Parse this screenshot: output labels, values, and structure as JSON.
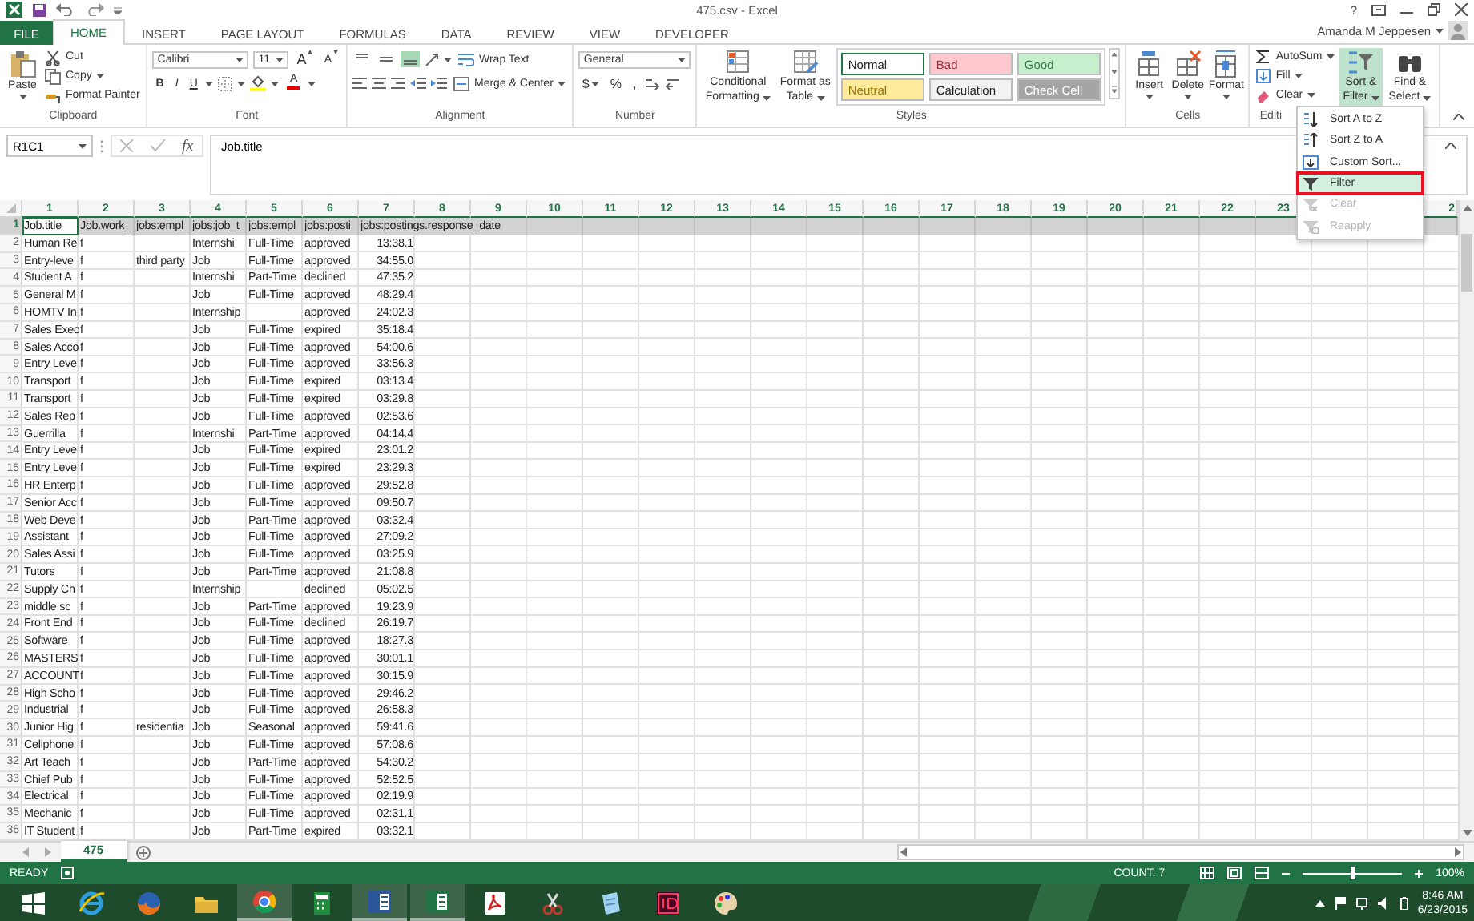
{
  "title_bar": {
    "title": "475.csv - Excel",
    "help": "?"
  },
  "tabs": [
    {
      "label": "FILE",
      "kind": "file",
      "selected": false
    },
    {
      "label": "HOME",
      "kind": "tab",
      "selected": true
    },
    {
      "label": "INSERT",
      "kind": "tab",
      "selected": false
    },
    {
      "label": "PAGE LAYOUT",
      "kind": "tab",
      "selected": false
    },
    {
      "label": "FORMULAS",
      "kind": "tab",
      "selected": false
    },
    {
      "label": "DATA",
      "kind": "tab",
      "selected": false
    },
    {
      "label": "REVIEW",
      "kind": "tab",
      "selected": false
    },
    {
      "label": "VIEW",
      "kind": "tab",
      "selected": false
    },
    {
      "label": "DEVELOPER",
      "kind": "tab",
      "selected": false
    }
  ],
  "account": {
    "name": "Amanda M Jeppesen"
  },
  "ribbon": {
    "groups": [
      {
        "kind": "clipboard",
        "label": "Clipboard",
        "paste": "Paste",
        "commands": [
          "Cut",
          "Copy",
          "Format Painter"
        ]
      },
      {
        "kind": "font",
        "label": "Font",
        "font_name": "Calibri",
        "font_size": "11",
        "grow": "A",
        "shrink": "A",
        "styles": [
          "B",
          "I",
          "U"
        ],
        "color_letter": "A"
      },
      {
        "kind": "alignment",
        "label": "Alignment",
        "vertical_alignment": [
          {
            "selected": false
          },
          {
            "selected": false
          },
          {
            "selected": true
          }
        ],
        "commands": [
          "Wrap Text",
          "Merge & Center"
        ]
      },
      {
        "kind": "number",
        "label": "Number",
        "format": "General",
        "symbols": [
          "$",
          "%",
          ","
        ]
      },
      {
        "kind": "styles",
        "label": "Styles",
        "commands": [
          [
            "Conditional",
            "Formatting"
          ],
          [
            "Format as",
            "Table"
          ]
        ],
        "cell_styles": [
          {
            "label": "Normal",
            "color": "#ffffff",
            "selected": true
          },
          {
            "label": "Bad",
            "color": "#ffc7ce",
            "selected": false
          },
          {
            "label": "Good",
            "color": "#c6efce",
            "selected": false
          },
          {
            "label": "Neutral",
            "color": "#ffeb9c",
            "selected": false
          },
          {
            "label": "Calculation",
            "color": "#f2f2f2",
            "selected": false
          },
          {
            "label": "Check Cell",
            "color": "#a5a5a5",
            "selected": false
          }
        ]
      },
      {
        "kind": "cells",
        "label": "Cells",
        "commands": [
          "Insert",
          "Delete",
          "Format"
        ]
      },
      {
        "kind": "editing",
        "label": "Editi",
        "commands": [
          "AutoSum",
          "Fill",
          "Clear"
        ],
        "sort": {
          "lines": [
            "Sort &",
            "Filter"
          ],
          "active": true
        },
        "find": [
          "Find &",
          "Select"
        ]
      }
    ]
  },
  "formula_bar": {
    "name_box": "R1C1",
    "function_symbol": "fx",
    "content": "Job.title"
  },
  "sheet": {
    "columns": [
      "1",
      "2",
      "3",
      "4",
      "5",
      "6",
      "7",
      "8",
      "9",
      "10",
      "11",
      "12",
      "13",
      "14",
      "15",
      "16",
      "17",
      "18",
      "19",
      "20",
      "21",
      "22",
      "23",
      null,
      null,
      "2"
    ],
    "rows": [
      {
        "header": "1",
        "selected": true,
        "cells": [
          "Job.title",
          "Job.work_",
          "jobs:empl",
          "jobs:job_t",
          "jobs:empl",
          "jobs:posti",
          "jobs:postings.response_date"
        ]
      },
      {
        "header": "2",
        "selected": false,
        "cells": [
          "Human Re",
          "f",
          null,
          "Internshi",
          "Full-Time",
          "approved",
          "13:38.1"
        ]
      },
      {
        "header": "3",
        "selected": false,
        "cells": [
          "Entry-leve",
          "f",
          "third party",
          "Job",
          "Full-Time",
          "approved",
          "34:55.0"
        ]
      },
      {
        "header": "4",
        "selected": false,
        "cells": [
          "Student A",
          "f",
          null,
          "Internshi",
          "Part-Time",
          "declined",
          "47:35.2"
        ]
      },
      {
        "header": "5",
        "selected": false,
        "cells": [
          "General M",
          "f",
          null,
          "Job",
          "Full-Time",
          "approved",
          "48:29.4"
        ]
      },
      {
        "header": "6",
        "selected": false,
        "cells": [
          "HOMTV In",
          "f",
          null,
          "Internship",
          null,
          "approved",
          "24:02.3"
        ]
      },
      {
        "header": "7",
        "selected": false,
        "cells": [
          "Sales Exec",
          "f",
          null,
          "Job",
          "Full-Time",
          "expired",
          "35:18.4"
        ]
      },
      {
        "header": "8",
        "selected": false,
        "cells": [
          "Sales Acco",
          "f",
          null,
          "Job",
          "Full-Time",
          "approved",
          "54:00.6"
        ]
      },
      {
        "header": "9",
        "selected": false,
        "cells": [
          "Entry Leve",
          "f",
          null,
          "Job",
          "Full-Time",
          "approved",
          "33:56.3"
        ]
      },
      {
        "header": "10",
        "selected": false,
        "cells": [
          "Transport",
          "f",
          null,
          "Job",
          "Full-Time",
          "expired",
          "03:13.4"
        ]
      },
      {
        "header": "11",
        "selected": false,
        "cells": [
          "Transport",
          "f",
          null,
          "Job",
          "Full-Time",
          "expired",
          "03:29.8"
        ]
      },
      {
        "header": "12",
        "selected": false,
        "cells": [
          "Sales Rep",
          "f",
          null,
          "Job",
          "Full-Time",
          "approved",
          "02:53.6"
        ]
      },
      {
        "header": "13",
        "selected": false,
        "cells": [
          "Guerrilla",
          "f",
          null,
          "Internshi",
          "Part-Time",
          "approved",
          "04:14.4"
        ]
      },
      {
        "header": "14",
        "selected": false,
        "cells": [
          "Entry Leve",
          "f",
          null,
          "Job",
          "Full-Time",
          "expired",
          "23:01.2"
        ]
      },
      {
        "header": "15",
        "selected": false,
        "cells": [
          "Entry Leve",
          "f",
          null,
          "Job",
          "Full-Time",
          "expired",
          "23:29.3"
        ]
      },
      {
        "header": "16",
        "selected": false,
        "cells": [
          "HR Enterp",
          "f",
          null,
          "Job",
          "Full-Time",
          "approved",
          "29:52.8"
        ]
      },
      {
        "header": "17",
        "selected": false,
        "cells": [
          "Senior Acc",
          "f",
          null,
          "Job",
          "Full-Time",
          "approved",
          "09:50.7"
        ]
      },
      {
        "header": "18",
        "selected": false,
        "cells": [
          "Web Deve",
          "f",
          null,
          "Job",
          "Part-Time",
          "approved",
          "03:32.4"
        ]
      },
      {
        "header": "19",
        "selected": false,
        "cells": [
          "Assistant",
          "f",
          null,
          "Job",
          "Full-Time",
          "approved",
          "27:09.2"
        ]
      },
      {
        "header": "20",
        "selected": false,
        "cells": [
          "Sales Assi",
          "f",
          null,
          "Job",
          "Full-Time",
          "approved",
          "03:25.9"
        ]
      },
      {
        "header": "21",
        "selected": false,
        "cells": [
          "Tutors",
          "f",
          null,
          "Job",
          "Part-Time",
          "approved",
          "21:08.8"
        ]
      },
      {
        "header": "22",
        "selected": false,
        "cells": [
          "Supply Ch",
          "f",
          null,
          "Internship",
          null,
          "declined",
          "05:02.5"
        ]
      },
      {
        "header": "23",
        "selected": false,
        "cells": [
          "middle sc",
          "f",
          null,
          "Job",
          "Part-Time",
          "approved",
          "19:23.9"
        ]
      },
      {
        "header": "24",
        "selected": false,
        "cells": [
          "Front End",
          "f",
          null,
          "Job",
          "Full-Time",
          "declined",
          "26:19.7"
        ]
      },
      {
        "header": "25",
        "selected": false,
        "cells": [
          "Software",
          "f",
          null,
          "Job",
          "Full-Time",
          "approved",
          "18:27.3"
        ]
      },
      {
        "header": "26",
        "selected": false,
        "cells": [
          "MASTERS",
          "f",
          null,
          "Job",
          "Full-Time",
          "approved",
          "30:01.1"
        ]
      },
      {
        "header": "27",
        "selected": false,
        "cells": [
          "ACCOUNT",
          "f",
          null,
          "Job",
          "Full-Time",
          "approved",
          "30:15.9"
        ]
      },
      {
        "header": "28",
        "selected": false,
        "cells": [
          "High Scho",
          "f",
          null,
          "Job",
          "Full-Time",
          "approved",
          "29:46.2"
        ]
      },
      {
        "header": "29",
        "selected": false,
        "cells": [
          "Industrial",
          "f",
          null,
          "Job",
          "Full-Time",
          "approved",
          "26:58.3"
        ]
      },
      {
        "header": "30",
        "selected": false,
        "cells": [
          "Junior Hig",
          "f",
          "residentia",
          "Job",
          "Seasonal",
          "approved",
          "59:41.6"
        ]
      },
      {
        "header": "31",
        "selected": false,
        "cells": [
          "Cellphone",
          "f",
          null,
          "Job",
          "Full-Time",
          "approved",
          "57:08.6"
        ]
      },
      {
        "header": "32",
        "selected": false,
        "cells": [
          "Art Teach",
          "f",
          null,
          "Job",
          "Part-Time",
          "approved",
          "54:30.2"
        ]
      },
      {
        "header": "33",
        "selected": false,
        "cells": [
          "Chief Pub",
          "f",
          null,
          "Job",
          "Full-Time",
          "approved",
          "52:52.5"
        ]
      },
      {
        "header": "34",
        "selected": false,
        "cells": [
          "Electrical",
          "f",
          null,
          "Job",
          "Full-Time",
          "approved",
          "02:19.9"
        ]
      },
      {
        "header": "35",
        "selected": false,
        "cells": [
          "Mechanic",
          "f",
          null,
          "Job",
          "Full-Time",
          "approved",
          "02:31.1"
        ]
      },
      {
        "header": "36",
        "selected": false,
        "cells": [
          "IT Student",
          "f",
          null,
          "Job",
          "Part-Time",
          "expired",
          "03:32.1"
        ]
      }
    ]
  },
  "sort_menu": {
    "items": [
      {
        "label": "Sort A to Z",
        "disabled": false,
        "selected": false
      },
      {
        "label": "Sort Z to A",
        "disabled": false,
        "selected": false
      },
      {
        "label": "Custom Sort...",
        "disabled": false,
        "selected": false
      },
      {
        "label": "Filter",
        "disabled": false,
        "selected": true
      },
      {
        "label": "Clear",
        "disabled": true,
        "selected": false
      },
      {
        "label": "Reapply",
        "disabled": true,
        "selected": false
      }
    ]
  },
  "sheet_tabs": [
    {
      "label": "475",
      "selected": true
    }
  ],
  "status_bar": {
    "mode": "READY",
    "count": "COUNT: 7",
    "zoom": "100%",
    "zoom_slider": {
      "level": 0.5
    }
  },
  "taskbar": {
    "apps": [
      {
        "kind": "ie",
        "running": false
      },
      {
        "kind": "firefox",
        "running": false
      },
      {
        "kind": "explorer",
        "running": false
      },
      {
        "kind": "chrome",
        "running": true
      },
      {
        "kind": "calculator",
        "running": false
      },
      {
        "kind": "word",
        "running": true
      },
      {
        "kind": "excel",
        "running": true
      },
      {
        "kind": "acrobat",
        "running": false
      },
      {
        "kind": "snipping",
        "running": false
      },
      {
        "kind": "notes",
        "running": false
      },
      {
        "kind": "indesign",
        "running": false
      },
      {
        "kind": "paint",
        "running": false
      }
    ],
    "time": "8:46 AM",
    "date": "6/23/2015"
  }
}
